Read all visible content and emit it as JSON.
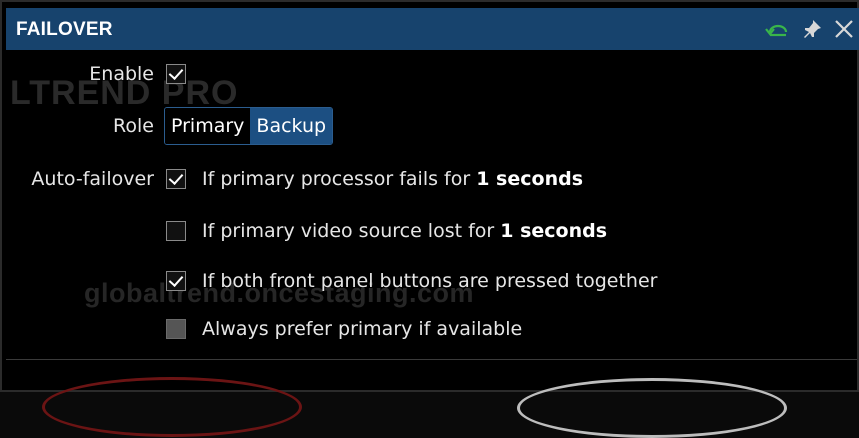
{
  "window": {
    "title": "FAILOVER"
  },
  "watermarks": {
    "brand": "LTREND PRO",
    "site": "globaltrend.oncestaging.com"
  },
  "form": {
    "enable_label": "Enable",
    "enable_checked": true,
    "role_label": "Role",
    "role_options": [
      "Primary",
      "Backup"
    ],
    "role_selected": "Backup",
    "autofailover_label": "Auto-failover",
    "options": [
      {
        "text": "If primary processor fails for ",
        "value": "1 seconds",
        "checked": true,
        "disabled": false
      },
      {
        "text": "If primary video source lost for ",
        "value": "1 seconds",
        "checked": false,
        "disabled": false
      },
      {
        "text": "If both front panel buttons are pressed together",
        "value": "",
        "checked": true,
        "disabled": false
      },
      {
        "text": "Always prefer primary if available",
        "value": "",
        "checked": false,
        "disabled": true
      }
    ]
  },
  "icons": {
    "refresh": "refresh-icon",
    "pin": "pin-icon",
    "close": "close-icon"
  },
  "colors": {
    "titlebar": "#17436d",
    "accent_green": "#39b54a",
    "segment_selected": "#1c4f82"
  }
}
